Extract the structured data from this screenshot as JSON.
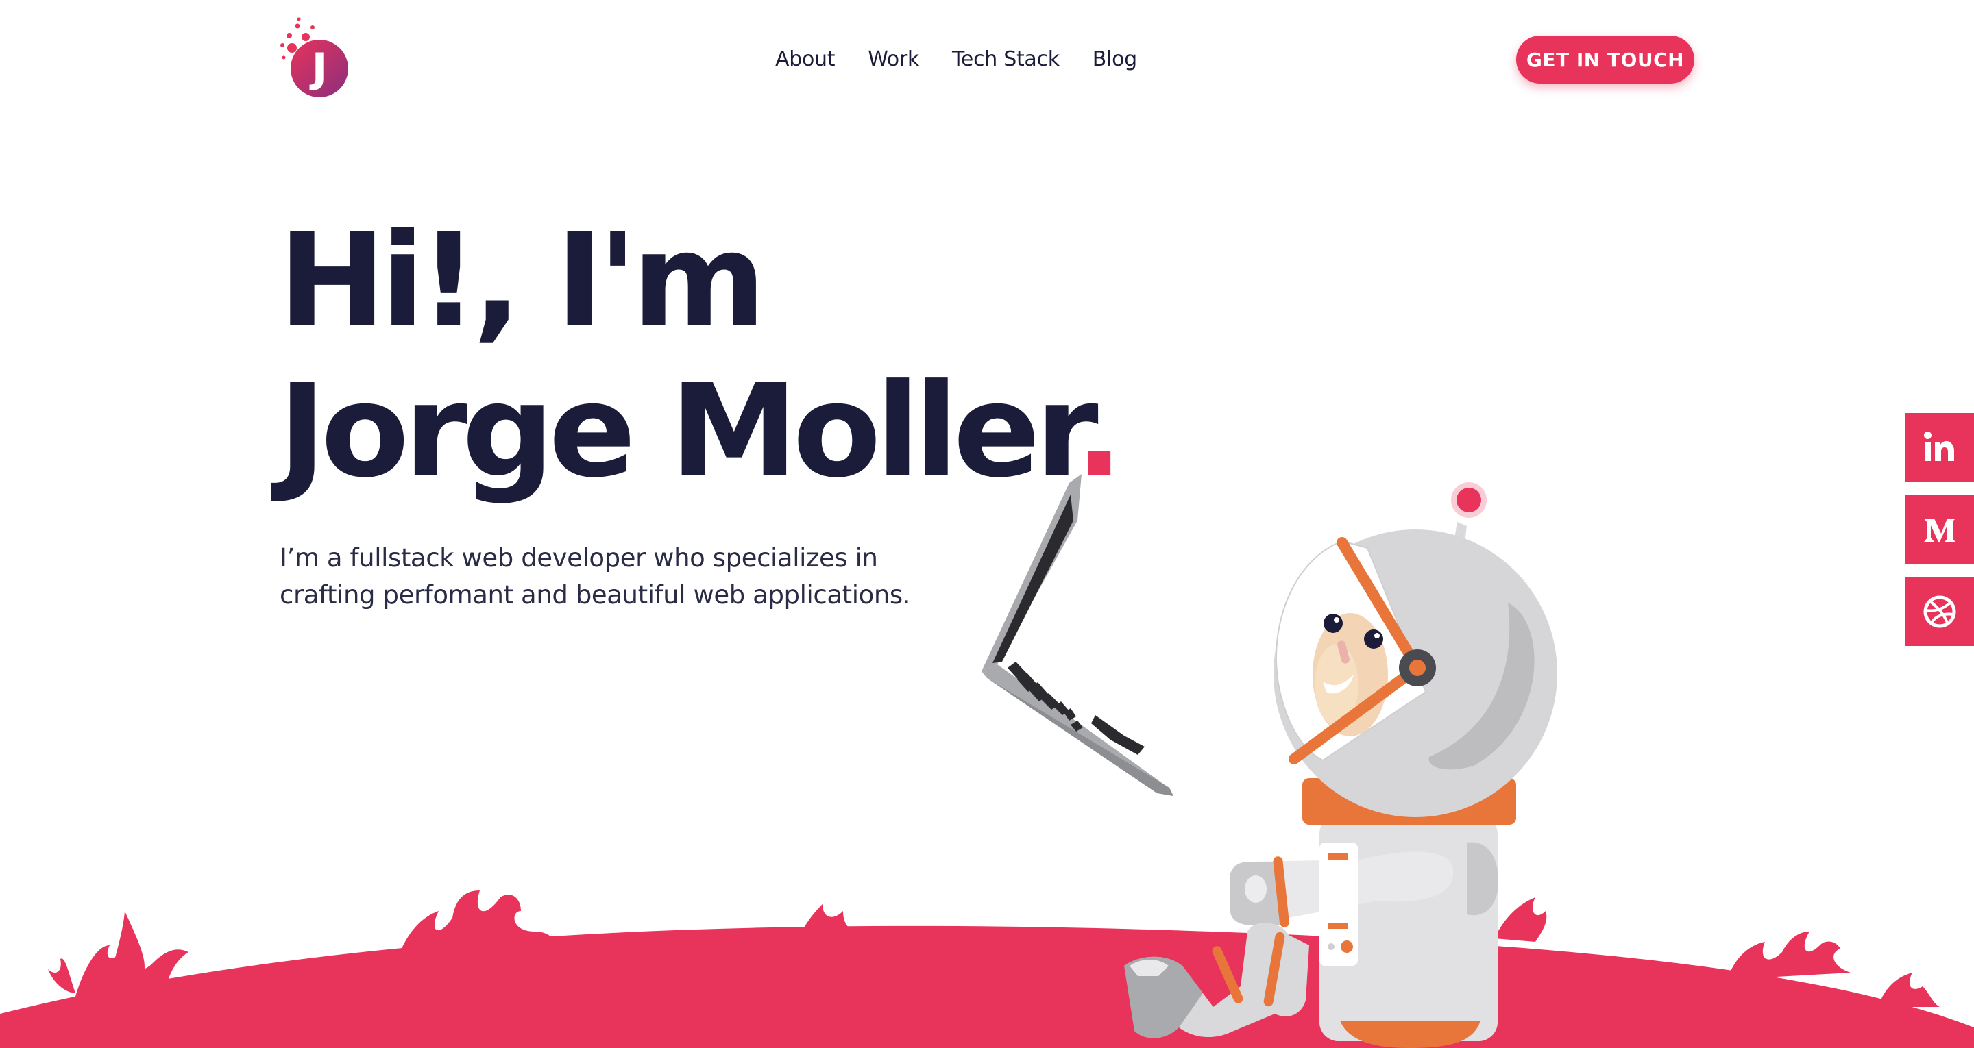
{
  "brand": {
    "logo_letter": "J"
  },
  "nav": {
    "items": [
      {
        "label": "About"
      },
      {
        "label": "Work"
      },
      {
        "label": "Tech Stack"
      },
      {
        "label": "Blog"
      }
    ],
    "cta_label": "GET IN TOUCH"
  },
  "hero": {
    "greeting": "Hi!, I'm",
    "name": "Jorge Moller",
    "name_punct": ".",
    "subtitle": "I’m a fullstack web developer who specializes in crafting perfomant and beautiful web applications."
  },
  "social": [
    {
      "icon": "linkedin-icon"
    },
    {
      "icon": "medium-icon"
    },
    {
      "icon": "dribbble-icon"
    }
  ],
  "colors": {
    "accent": "#e8335b",
    "text": "#1b1c3a",
    "ground": "#e8335b",
    "suit_orange": "#e8763a",
    "suit_gray": "#d9d9db"
  }
}
